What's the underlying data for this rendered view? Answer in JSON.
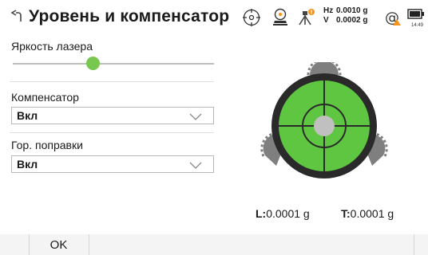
{
  "header": {
    "title": "Уровень и компенсатор",
    "tilt": {
      "h_label": "Hz",
      "h_value": "0.0010 g",
      "v_label": "V",
      "v_value": "0.0002 g"
    },
    "clock": "14:49",
    "icons": [
      "back-arrow-icon",
      "target-icon",
      "instrument-icon",
      "tripod-warning-icon",
      "at-warning-icon",
      "battery-icon"
    ]
  },
  "laser": {
    "label": "Яркость лазера",
    "level_fraction": 0.4
  },
  "compensator": {
    "label": "Компенсатор",
    "value": "Вкл"
  },
  "corrections": {
    "label": "Гор. поправки",
    "value": "Вкл"
  },
  "readouts": {
    "l_label": "L:",
    "l_value": "0.0001 g",
    "t_label": "T:",
    "t_value": "0.0001 g"
  },
  "footer": {
    "ok_label": "OK"
  },
  "colors": {
    "accent_green": "#78c850",
    "bubble_green": "#5fc641",
    "dark": "#2a2a2a",
    "warning_orange": "#f7941d",
    "knob_gray": "#7f7f7f"
  }
}
